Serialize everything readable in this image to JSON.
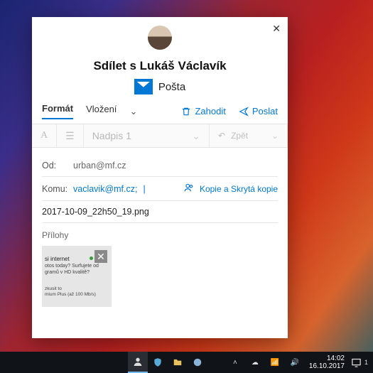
{
  "dialog": {
    "title": "Sdílet s Lukáš Václavík",
    "app_name": "Pošta",
    "tabs": {
      "format": "Formát",
      "insert": "Vložení"
    },
    "actions": {
      "discard": "Zahodit",
      "send": "Poslat"
    },
    "toolbar": {
      "heading_style": "Nadpis 1",
      "undo": "Zpět"
    },
    "fields": {
      "from_label": "Od:",
      "from_value": "urban@mf.cz",
      "to_label": "Komu:",
      "to_value": "vaclavik@mf.cz;",
      "cc_bcc": "Kopie a Skrytá kopie",
      "subject": "2017-10-09_22h50_19.png"
    },
    "attachments": {
      "label": "Přílohy",
      "thumb_title": "si internet",
      "thumb_line1": "otos today? Surfujete od",
      "thumb_line2": "gramů v HD kvalitě?",
      "thumb_footer1": "zkusit to",
      "thumb_footer2": "mium Plus (až 100 Mb/s)"
    }
  },
  "taskbar": {
    "time": "14:02",
    "date": "16.10.2017",
    "notif_count": "1"
  }
}
